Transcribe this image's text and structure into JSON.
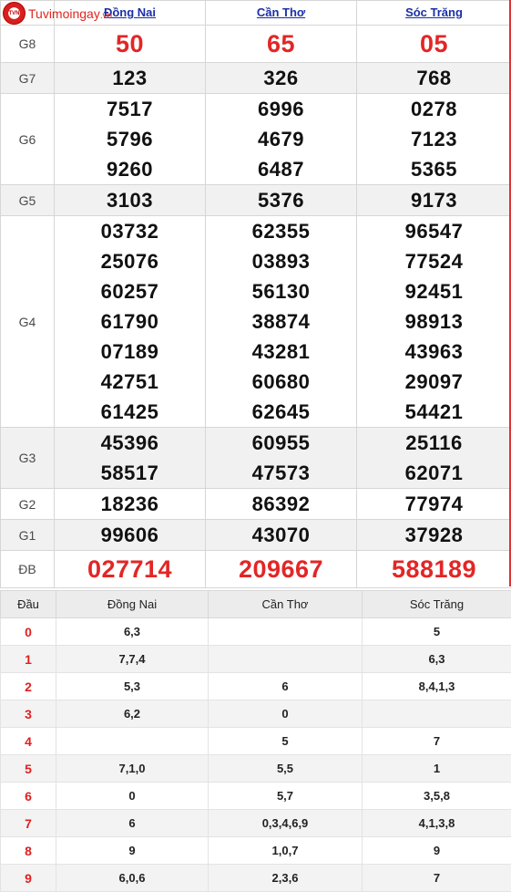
{
  "logo": {
    "badge_text": "TVN",
    "text": "Tuvimoingay",
    "ext": ".vn"
  },
  "provinces": [
    "Đồng Nai",
    "Cần Thơ",
    "Sóc Trăng"
  ],
  "results": {
    "g8": {
      "label": "G8",
      "values": [
        "50",
        "65",
        "05"
      ]
    },
    "g7": {
      "label": "G7",
      "values": [
        "123",
        "326",
        "768"
      ]
    },
    "g6": {
      "label": "G6",
      "values": [
        [
          "7517",
          "5796",
          "9260"
        ],
        [
          "6996",
          "4679",
          "6487"
        ],
        [
          "0278",
          "7123",
          "5365"
        ]
      ]
    },
    "g5": {
      "label": "G5",
      "values": [
        "3103",
        "5376",
        "9173"
      ]
    },
    "g4": {
      "label": "G4",
      "values": [
        [
          "03732",
          "25076",
          "60257",
          "61790",
          "07189",
          "42751",
          "61425"
        ],
        [
          "62355",
          "03893",
          "56130",
          "38874",
          "43281",
          "60680",
          "62645"
        ],
        [
          "96547",
          "77524",
          "92451",
          "98913",
          "43963",
          "29097",
          "54421"
        ]
      ]
    },
    "g3": {
      "label": "G3",
      "values": [
        [
          "45396",
          "58517"
        ],
        [
          "60955",
          "47573"
        ],
        [
          "25116",
          "62071"
        ]
      ]
    },
    "g2": {
      "label": "G2",
      "values": [
        "18236",
        "86392",
        "77974"
      ]
    },
    "g1": {
      "label": "G1",
      "values": [
        "99606",
        "43070",
        "37928"
      ]
    },
    "db": {
      "label": "ĐB",
      "values": [
        "027714",
        "209667",
        "588189"
      ]
    }
  },
  "loto": {
    "headers": [
      "Đầu",
      "Đồng Nai",
      "Cần Thơ",
      "Sóc Trăng"
    ],
    "rows": [
      {
        "head": "0",
        "cols": [
          "6,3",
          "",
          "5"
        ]
      },
      {
        "head": "1",
        "cols": [
          "7,7,4",
          "",
          "6,3"
        ]
      },
      {
        "head": "2",
        "cols": [
          "5,3",
          "6",
          "8,4,1,3"
        ]
      },
      {
        "head": "3",
        "cols": [
          "6,2",
          "0",
          ""
        ]
      },
      {
        "head": "4",
        "cols": [
          "",
          "5",
          "7"
        ]
      },
      {
        "head": "5",
        "cols": [
          "7,1,0",
          "5,5",
          "1"
        ]
      },
      {
        "head": "6",
        "cols": [
          "0",
          "5,7",
          "3,5,8"
        ]
      },
      {
        "head": "7",
        "cols": [
          "6",
          "0,3,4,6,9",
          "4,1,3,8"
        ]
      },
      {
        "head": "8",
        "cols": [
          "9",
          "1,0,7",
          "9"
        ]
      },
      {
        "head": "9",
        "cols": [
          "6,0,6",
          "2,3,6",
          "7"
        ]
      }
    ]
  }
}
